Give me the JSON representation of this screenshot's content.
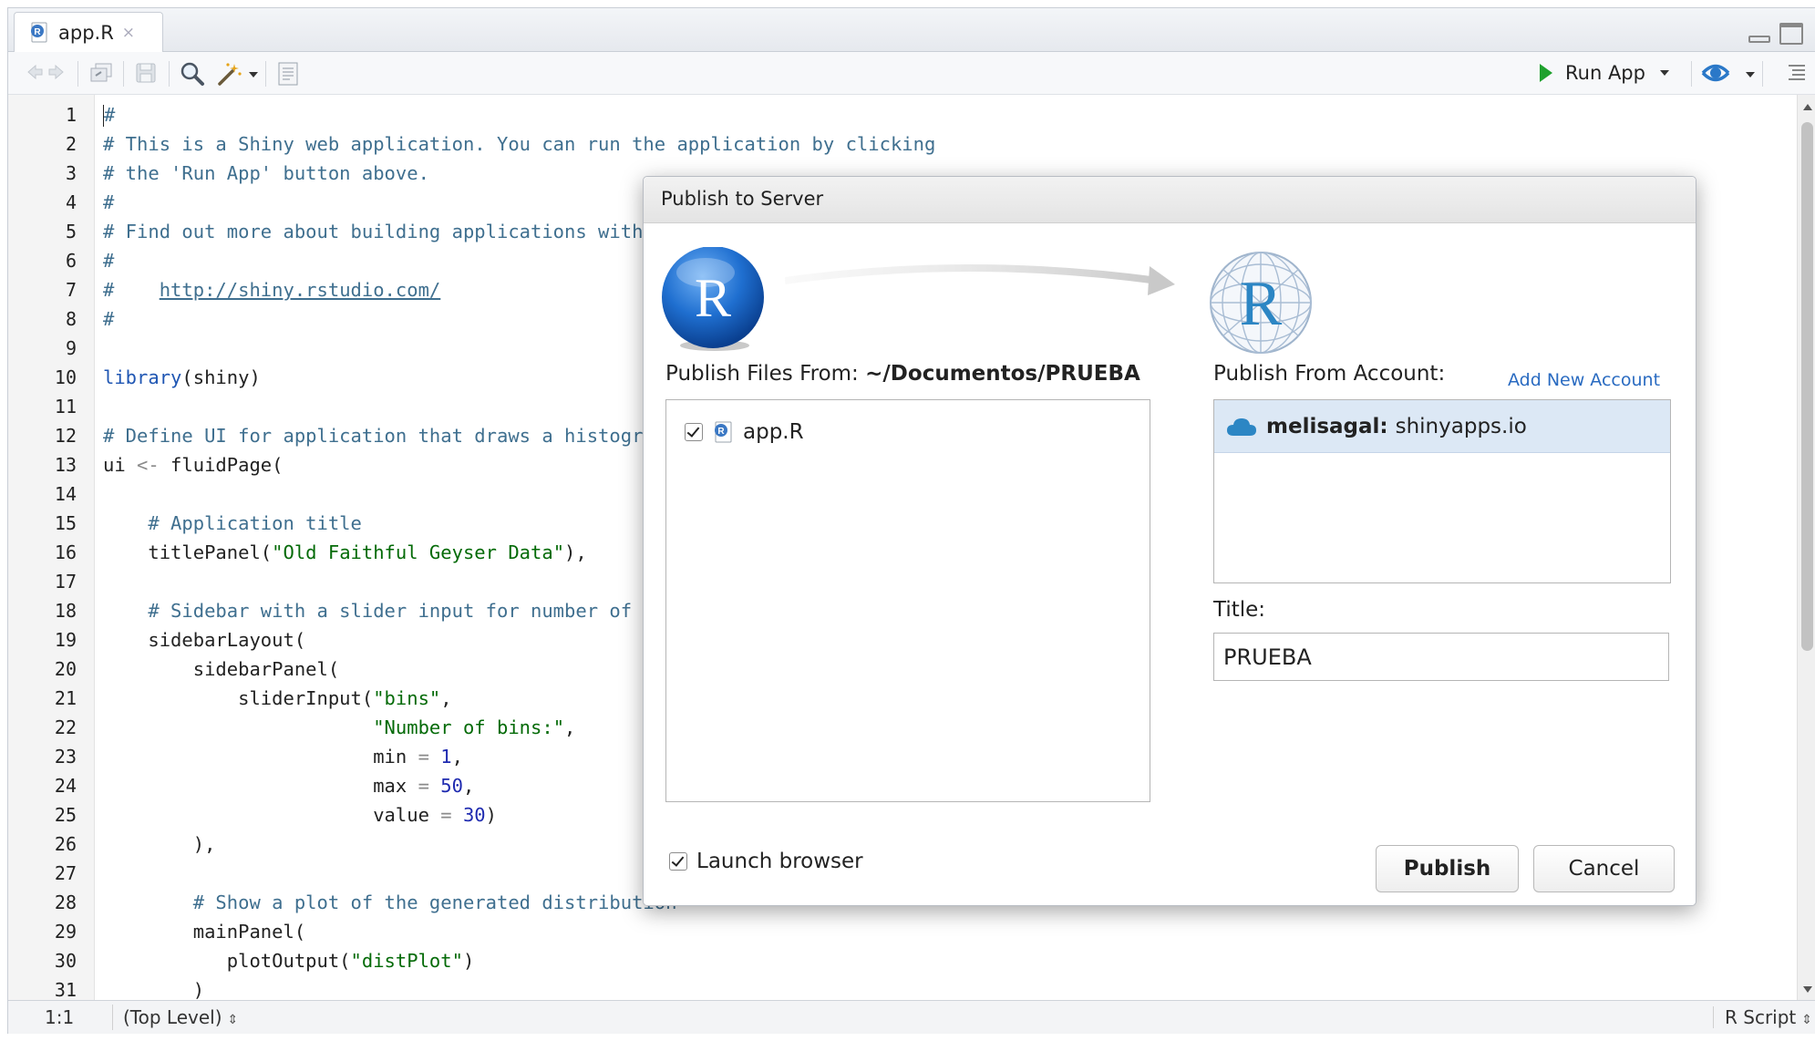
{
  "editor": {
    "tab": {
      "filename": "app.R",
      "close_glyph": "×"
    },
    "toolbar": {
      "run_app_label": "Run App"
    },
    "code_lines": [
      [
        {
          "t": "#",
          "c": "cmt"
        }
      ],
      [
        {
          "t": "# This is a Shiny web application. You can run the application by clicking",
          "c": "cmt"
        }
      ],
      [
        {
          "t": "# the 'Run App' button above.",
          "c": "cmt"
        }
      ],
      [
        {
          "t": "#",
          "c": "cmt"
        }
      ],
      [
        {
          "t": "# Find out more about building applications with Shiny here:",
          "c": "cmt"
        }
      ],
      [
        {
          "t": "#",
          "c": "cmt"
        }
      ],
      [
        {
          "t": "#    ",
          "c": "cmt"
        },
        {
          "t": "http://shiny.rstudio.com/",
          "c": "link"
        }
      ],
      [
        {
          "t": "#",
          "c": "cmt"
        }
      ],
      [],
      [
        {
          "t": "library",
          "c": "kw"
        },
        {
          "t": "(shiny)",
          "c": ""
        }
      ],
      [],
      [
        {
          "t": "# Define UI for application that draws a histogram",
          "c": "cmt"
        }
      ],
      [
        {
          "t": "ui ",
          "c": ""
        },
        {
          "t": "<-",
          "c": "op"
        },
        {
          "t": " fluidPage(",
          "c": ""
        }
      ],
      [],
      [
        {
          "t": "    # Application title",
          "c": "cmt"
        }
      ],
      [
        {
          "t": "    titlePanel(",
          "c": ""
        },
        {
          "t": "\"Old Faithful Geyser Data\"",
          "c": "str"
        },
        {
          "t": "),",
          "c": ""
        }
      ],
      [],
      [
        {
          "t": "    # Sidebar with a slider input for number of bins",
          "c": "cmt"
        }
      ],
      [
        {
          "t": "    sidebarLayout(",
          "c": ""
        }
      ],
      [
        {
          "t": "        sidebarPanel(",
          "c": ""
        }
      ],
      [
        {
          "t": "            sliderInput(",
          "c": ""
        },
        {
          "t": "\"bins\"",
          "c": "str"
        },
        {
          "t": ",",
          "c": ""
        }
      ],
      [
        {
          "t": "                        ",
          "c": ""
        },
        {
          "t": "\"Number of bins:\"",
          "c": "str"
        },
        {
          "t": ",",
          "c": ""
        }
      ],
      [
        {
          "t": "                        min ",
          "c": ""
        },
        {
          "t": "=",
          "c": "op"
        },
        {
          "t": " ",
          "c": ""
        },
        {
          "t": "1",
          "c": "num"
        },
        {
          "t": ",",
          "c": ""
        }
      ],
      [
        {
          "t": "                        max ",
          "c": ""
        },
        {
          "t": "=",
          "c": "op"
        },
        {
          "t": " ",
          "c": ""
        },
        {
          "t": "50",
          "c": "num"
        },
        {
          "t": ",",
          "c": ""
        }
      ],
      [
        {
          "t": "                        value ",
          "c": ""
        },
        {
          "t": "=",
          "c": "op"
        },
        {
          "t": " ",
          "c": ""
        },
        {
          "t": "30",
          "c": "num"
        },
        {
          "t": ")",
          "c": ""
        }
      ],
      [
        {
          "t": "        ),",
          "c": ""
        }
      ],
      [],
      [
        {
          "t": "        # Show a plot of the generated distribution",
          "c": "cmt"
        }
      ],
      [
        {
          "t": "        mainPanel(",
          "c": ""
        }
      ],
      [
        {
          "t": "           plotOutput(",
          "c": ""
        },
        {
          "t": "\"distPlot\"",
          "c": "str"
        },
        {
          "t": ")",
          "c": ""
        }
      ],
      [
        {
          "t": "        )",
          "c": ""
        }
      ]
    ],
    "status": {
      "position": "1:1",
      "scope": "(Top Level)",
      "file_type": "R Script"
    }
  },
  "dialog": {
    "title": "Publish to Server",
    "publish_files_from_label": "Publish Files From:",
    "publish_files_from_path": "~/Documentos/PRUEBA",
    "files": [
      {
        "name": "app.R",
        "checked": true
      }
    ],
    "publish_from_account_label": "Publish From Account:",
    "add_account_link": "Add New Account",
    "account": {
      "name": "melisagal:",
      "server": "shinyapps.io"
    },
    "title_label": "Title:",
    "title_value": "PRUEBA",
    "launch_browser_label": "Launch browser",
    "launch_browser_checked": true,
    "publish_button": "Publish",
    "cancel_button": "Cancel"
  },
  "colors": {
    "accent_blue": "#2a6bc1",
    "selection_bg": "#dce8f5",
    "run_green": "#1fa12e"
  },
  "icons": [
    "r-file-icon",
    "close-icon",
    "back-icon",
    "forward-icon",
    "show-in-window-icon",
    "save-icon",
    "search-icon",
    "magic-wand-icon",
    "compile-report-icon",
    "run-app-icon",
    "publish-icon",
    "outline-icon",
    "r-logo-icon",
    "r-globe-logo-icon",
    "cloud-icon",
    "checkbox-icon"
  ]
}
